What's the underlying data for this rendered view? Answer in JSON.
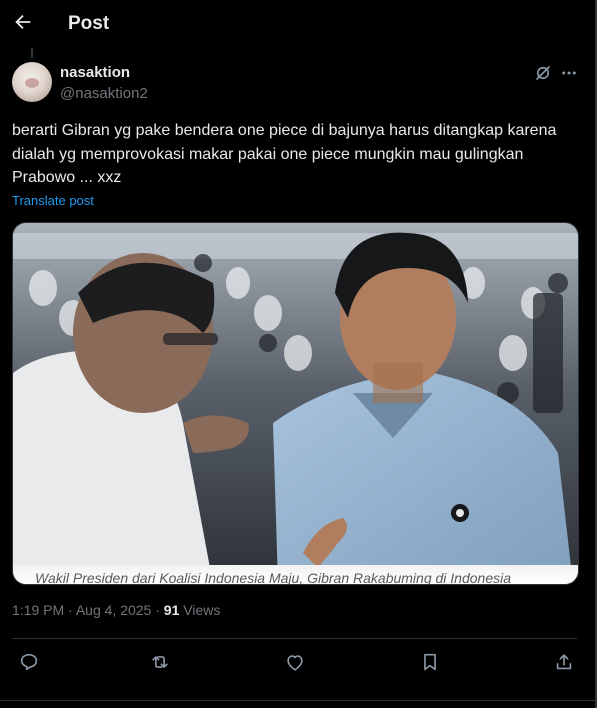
{
  "header": {
    "title": "Post",
    "back_icon": "arrow-left-icon"
  },
  "author": {
    "name": "nasaktion",
    "handle": "@nasaktion2"
  },
  "post": {
    "text": "berarti Gibran yg pake bendera one piece di bajunya harus ditangkap karena dialah yg memprovokasi makar pakai one piece mungkin mau gulingkan Prabowo ... xxz",
    "translate_label": "Translate post"
  },
  "media": {
    "caption": "Wakil Presiden dari Koalisi Indonesia Maju, Gibran Rakabuming di Indonesia"
  },
  "meta": {
    "time": "1:19 PM",
    "date": "Aug 4, 2025",
    "views_count": "91",
    "views_label": "Views",
    "sep": "·"
  },
  "actions": [
    "reply-icon",
    "repost-icon",
    "like-icon",
    "bookmark-icon",
    "share-icon"
  ],
  "colors": {
    "background": "#000000",
    "text": "#e7e9ea",
    "muted": "#71767b",
    "link": "#1d9bf0",
    "border": "#2f3336"
  }
}
